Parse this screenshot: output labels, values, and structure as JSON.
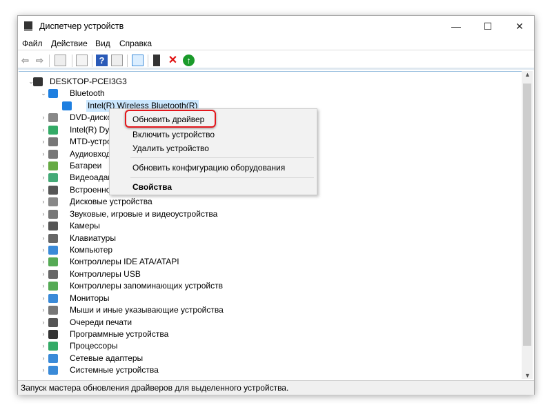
{
  "window": {
    "title": "Диспетчер устройств",
    "minimize": "—",
    "maximize": "☐",
    "close": "✕"
  },
  "menu": [
    "Файл",
    "Действие",
    "Вид",
    "Справка"
  ],
  "tree": [
    {
      "label": "DESKTOP-PCEI3G3",
      "level": 0,
      "expanded": true,
      "icon": "computer-icon",
      "color": "#333"
    },
    {
      "label": "Bluetooth",
      "level": 1,
      "expanded": true,
      "icon": "bluetooth-icon",
      "color": "#1e7fe0"
    },
    {
      "label": "Intel(R) Wireless Bluetooth(R)",
      "level": 2,
      "selected": true,
      "icon": "bluetooth-device-icon",
      "color": "#1e7fe0"
    },
    {
      "label": "DVD-дисководы и дисководы компакт-дисков",
      "level": 1,
      "icon": "dvd-drive-icon",
      "color": "#888"
    },
    {
      "label": "Intel(R) Dynamic Platform and Thermal Framework",
      "level": 1,
      "icon": "chip-icon",
      "color": "#3a6"
    },
    {
      "label": "MTD-устройства",
      "level": 1,
      "icon": "drive-icon",
      "color": "#777"
    },
    {
      "label": "Аудиовходы и аудиовыходы",
      "level": 1,
      "icon": "speaker-icon",
      "color": "#777"
    },
    {
      "label": "Батареи",
      "level": 1,
      "icon": "battery-icon",
      "color": "#6a4"
    },
    {
      "label": "Видеоадаптеры",
      "level": 1,
      "icon": "display-adapter-icon",
      "color": "#4a7"
    },
    {
      "label": "Встроенное ПО",
      "level": 1,
      "icon": "firmware-icon",
      "color": "#555"
    },
    {
      "label": "Дисковые устройства",
      "level": 1,
      "icon": "disk-icon",
      "color": "#888"
    },
    {
      "label": "Звуковые, игровые и видеоустройства",
      "level": 1,
      "icon": "sound-icon",
      "color": "#777"
    },
    {
      "label": "Камеры",
      "level": 1,
      "icon": "camera-icon",
      "color": "#555"
    },
    {
      "label": "Клавиатуры",
      "level": 1,
      "icon": "keyboard-icon",
      "color": "#666"
    },
    {
      "label": "Компьютер",
      "level": 1,
      "icon": "monitor-icon",
      "color": "#3a8ad8"
    },
    {
      "label": "Контроллеры IDE ATA/ATAPI",
      "level": 1,
      "icon": "ide-controller-icon",
      "color": "#5a5"
    },
    {
      "label": "Контроллеры USB",
      "level": 1,
      "icon": "usb-icon",
      "color": "#666"
    },
    {
      "label": "Контроллеры запоминающих устройств",
      "level": 1,
      "icon": "storage-controller-icon",
      "color": "#5a5"
    },
    {
      "label": "Мониторы",
      "level": 1,
      "icon": "monitor-icon",
      "color": "#3a8ad8"
    },
    {
      "label": "Мыши и иные указывающие устройства",
      "level": 1,
      "icon": "mouse-icon",
      "color": "#777"
    },
    {
      "label": "Очереди печати",
      "level": 1,
      "icon": "printer-icon",
      "color": "#555"
    },
    {
      "label": "Программные устройства",
      "level": 1,
      "icon": "software-device-icon",
      "color": "#333"
    },
    {
      "label": "Процессоры",
      "level": 1,
      "icon": "processor-icon",
      "color": "#3a6"
    },
    {
      "label": "Сетевые адаптеры",
      "level": 1,
      "icon": "network-icon",
      "color": "#3a8ad8"
    },
    {
      "label": "Системные устройства",
      "level": 1,
      "icon": "system-device-icon",
      "color": "#3a8ad8"
    }
  ],
  "context_menu": {
    "update_driver": "Обновить драйвер",
    "enable": "Включить устройство",
    "uninstall": "Удалить устройство",
    "scan": "Обновить конфигурацию оборудования",
    "properties": "Свойства"
  },
  "status": "Запуск мастера обновления драйверов для выделенного устройства."
}
